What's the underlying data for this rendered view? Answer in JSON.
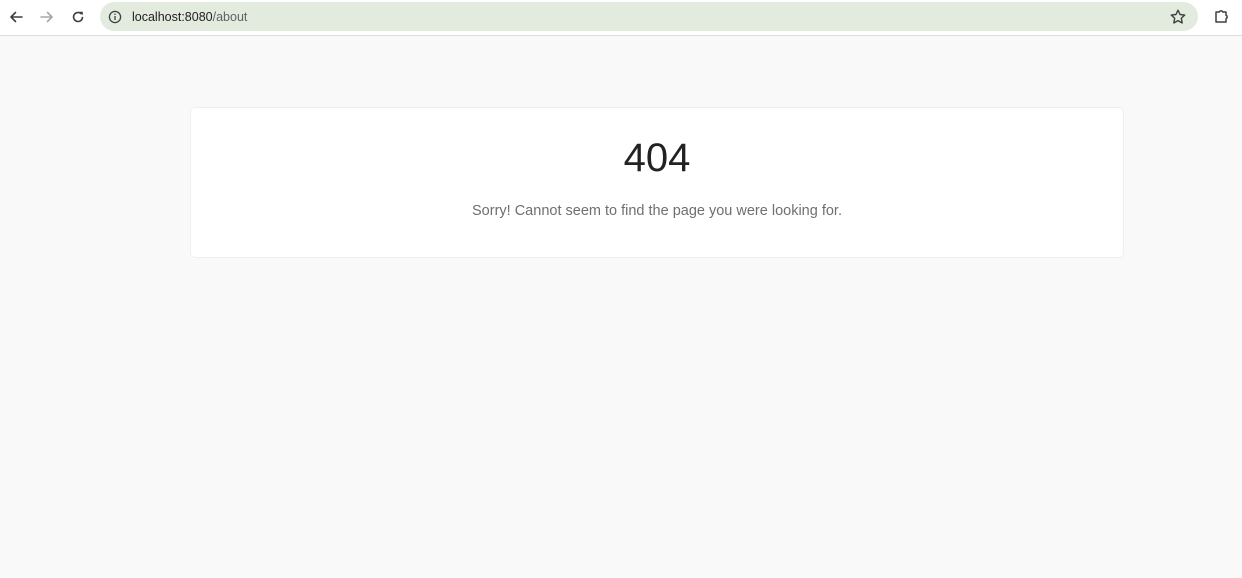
{
  "browser": {
    "url_host": "localhost:8080",
    "url_path": "/about",
    "icons": {
      "back": "back-arrow-icon",
      "forward": "forward-arrow-icon",
      "reload": "reload-icon",
      "site_info": "info-icon",
      "bookmark": "star-icon",
      "extensions": "puzzle-icon"
    },
    "omnibox_color": "#e3eade"
  },
  "page": {
    "background": "#f9f9f9",
    "error_code": "404",
    "error_message": "Sorry! Cannot seem to find the page you were looking for."
  }
}
